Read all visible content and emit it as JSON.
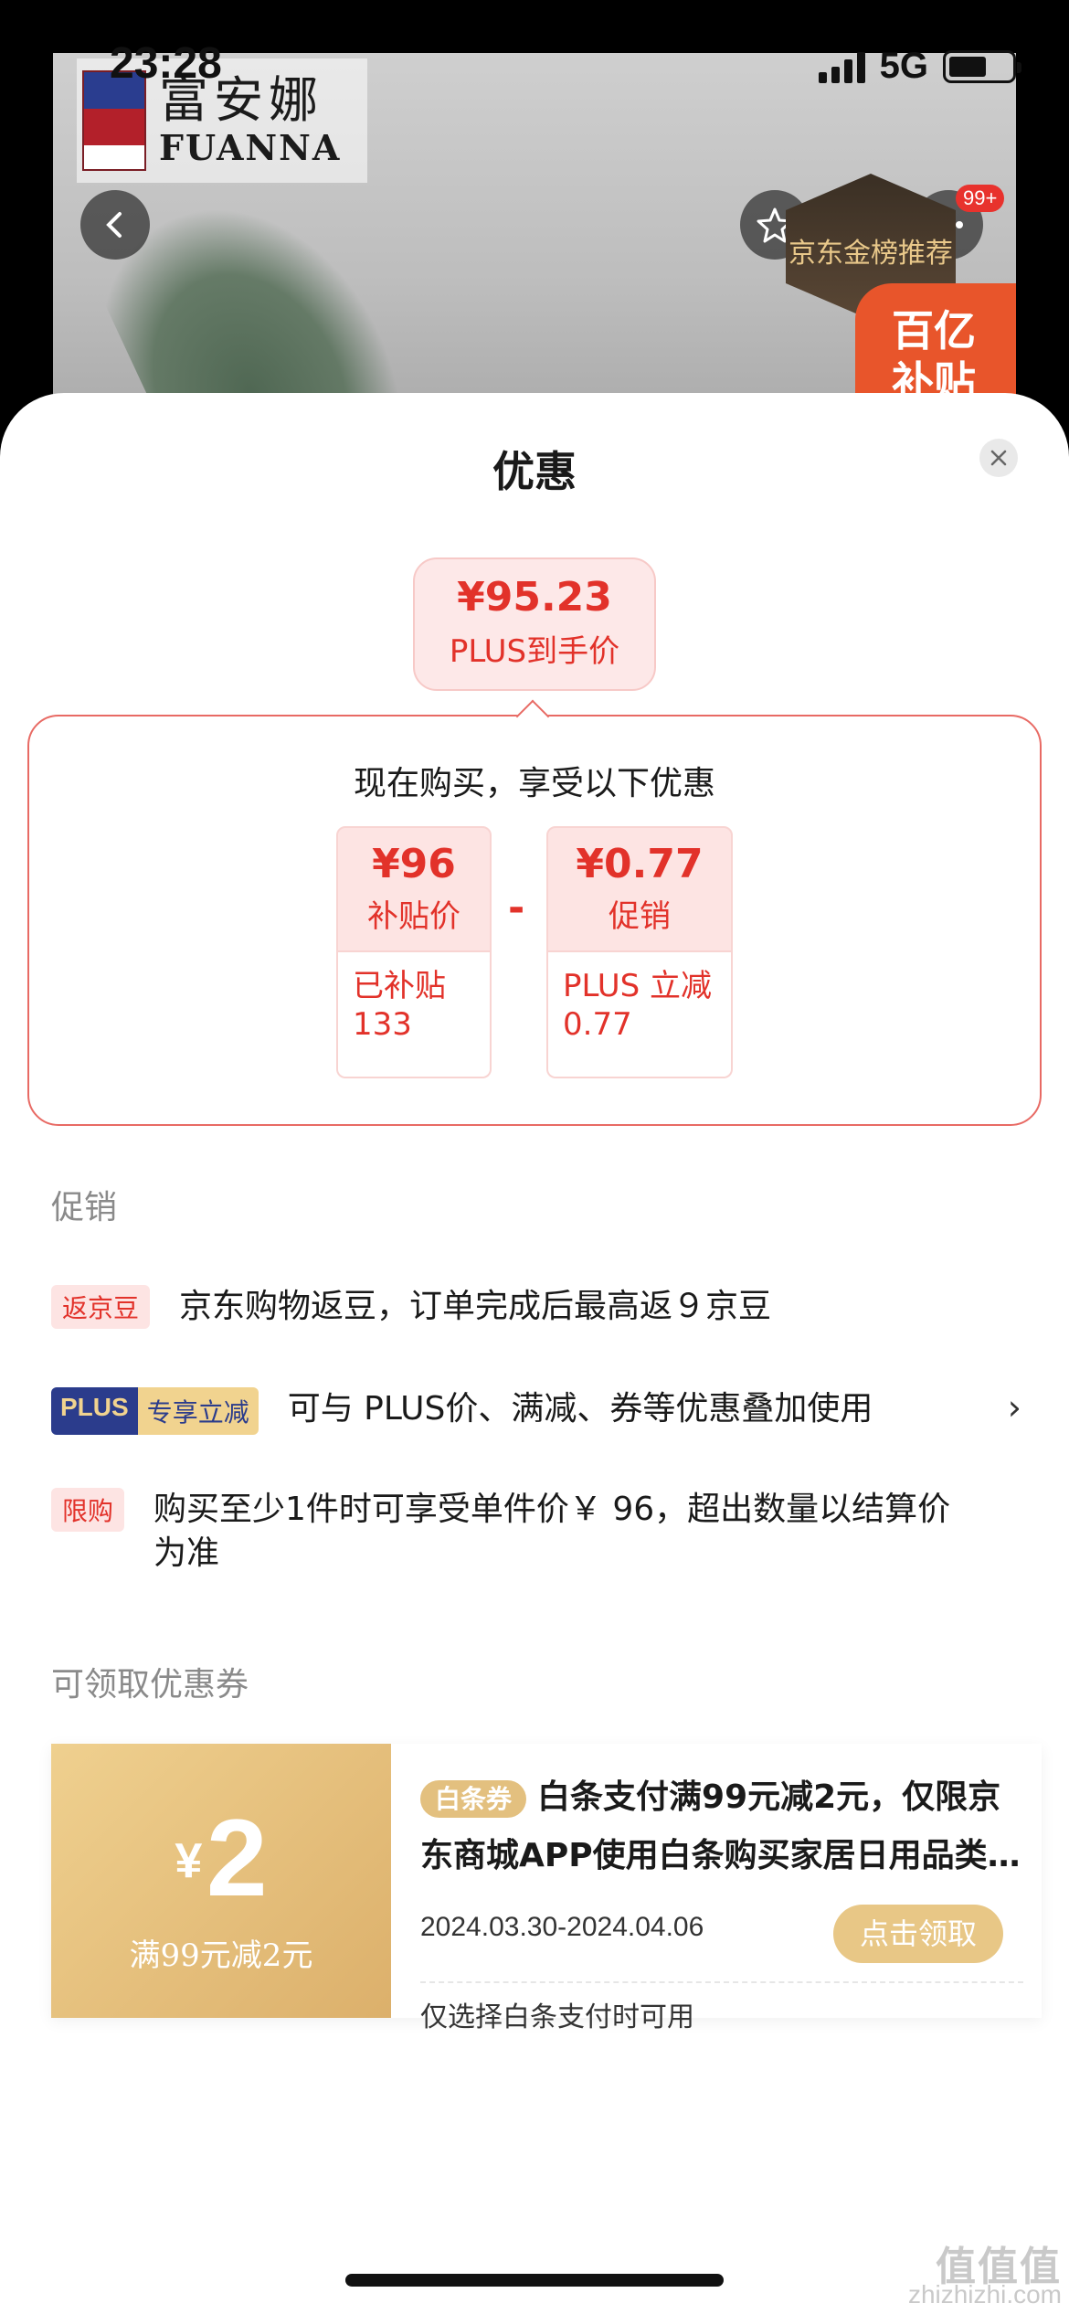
{
  "status_bar": {
    "time": "23:28",
    "network": "5G",
    "battery_level": 0.6
  },
  "brand": {
    "name_cn": "富安娜",
    "name_en": "FUANNA"
  },
  "top_overlay": {
    "notification_count": "99+",
    "rank_badge": "京东金榜推荐",
    "subsidy_tag": "百亿补贴"
  },
  "sheet": {
    "title": "优惠",
    "final_price": {
      "amount": "¥95.23",
      "label": "PLUS到手价"
    },
    "breakdown": {
      "title": "现在购买，享受以下优惠",
      "operator": "-",
      "cards": [
        {
          "value": "¥96",
          "label": "补贴价",
          "detail_line1": "已补贴",
          "detail_line2": "133"
        },
        {
          "value": "¥0.77",
          "label": "促销",
          "detail_line1": "PLUS 立减",
          "detail_line2": "0.77"
        }
      ]
    },
    "promotions": {
      "heading": "促销",
      "items": [
        {
          "tag": "返京豆",
          "text": "京东购物返豆，订单完成后最高返９京豆"
        },
        {
          "tag_a": "PLUS",
          "tag_b": "专享立减",
          "text": "可与 PLUS价、满减、券等优惠叠加使用",
          "chevron": "›"
        },
        {
          "tag": "限购",
          "text": "购买至少1件时可享受单件价￥ 96，超出数量以结算价为准"
        }
      ]
    },
    "coupons": {
      "heading": "可领取优惠券",
      "items": [
        {
          "currency": "¥",
          "amount": "2",
          "condition": "满99元减2元",
          "tag": "白条券",
          "title": "白条支付满99元减2元，仅限京东商城APP使用白条购买家居日用品类…",
          "date_range": "2024.03.30-2024.04.06",
          "button": "点击领取",
          "note": "仅选择白条支付时可用"
        }
      ]
    }
  },
  "watermark": {
    "logo": "值值值",
    "site": "zhizhizhi.com"
  },
  "colors": {
    "accent_red": "#e2322a",
    "gold": "#dcb06b",
    "plus_blue": "#2b3c8c"
  }
}
